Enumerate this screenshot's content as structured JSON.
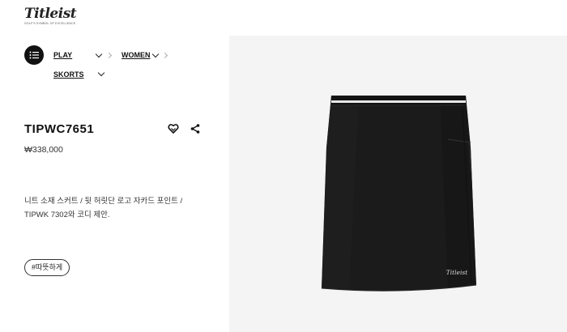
{
  "brand": {
    "logo_text": "Titleist",
    "tagline": "GOLF'S SYMBOL OF EXCELLENCE"
  },
  "breadcrumb": {
    "items": [
      {
        "label": "PLAY"
      },
      {
        "label": "WOMEN"
      },
      {
        "label": "SKORTS"
      }
    ]
  },
  "product": {
    "code": "TIPWC7651",
    "price": "₩338,000",
    "description_line1": "니트 소재 스커트 / 뒷 허릿단 로고 자카드 포인트 /",
    "description_line2": "TIPWK 7302와 코디 제안.",
    "tag": "#따뜻하게",
    "image_logo": "Titleist"
  },
  "colors": {
    "accent": "#111111",
    "image_bg": "#f4f4f4",
    "skirt": "#1b1b1b",
    "waistband_stripe": "#e8e8e8"
  },
  "icons": {
    "menu": "list-icon",
    "wishlist": "heart-icon",
    "share": "share-icon"
  }
}
